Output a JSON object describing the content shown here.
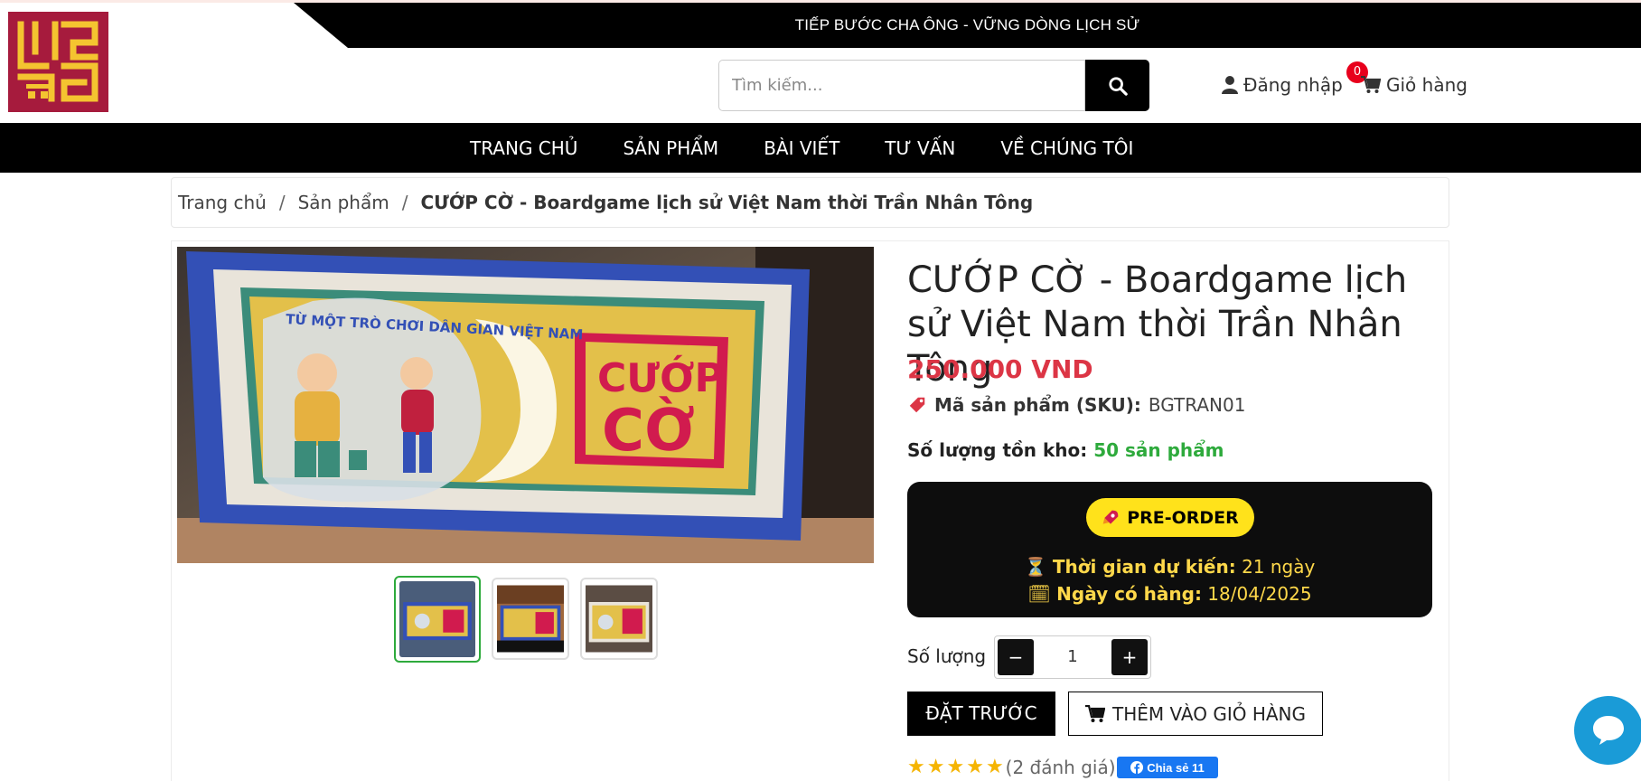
{
  "header": {
    "slogan": "TIẾP BƯỚC CHA ÔNG - VỮNG DÒNG LỊCH SỬ",
    "search_placeholder": "Tìm kiếm...",
    "login_label": "Đăng nhập",
    "cart_label": "Giỏ hàng",
    "cart_count": "0"
  },
  "nav": {
    "items": [
      "TRANG CHỦ",
      "SẢN PHẨM",
      "BÀI VIẾT",
      "TƯ VẤN",
      "VỀ CHÚNG TÔI"
    ]
  },
  "breadcrumb": {
    "items": [
      "Trang chủ",
      "Sản phẩm"
    ],
    "current": "CƯỚP CỜ - Boardgame lịch sử Việt Nam thời Trần Nhân Tông"
  },
  "product": {
    "title": "CƯỚP CỜ - Boardgame lịch sử Việt Nam thời Trần Nhân Tông",
    "price": "250.000 VND",
    "sku_label": "Mã sản phẩm (SKU):",
    "sku_value": "BGTRAN01",
    "stock_label": "Số lượng tồn kho:",
    "stock_value": "50 sản phẩm",
    "image_box_text_top": "TỪ MỘT TRÒ CHƠI DÂN GIAN VIỆT NAM",
    "image_box_title_1": "CƯỚP",
    "image_box_title_2": "CỜ"
  },
  "preorder": {
    "badge": "PRE-ORDER",
    "time_label": "Thời gian dự kiến:",
    "time_value": "21 ngày",
    "date_label": "Ngày có hàng:",
    "date_value": "18/04/2025"
  },
  "purchase": {
    "qty_label": "Số lượng",
    "qty_value": "1",
    "minus": "−",
    "plus": "+",
    "order_button": "ĐẶT TRƯỚC",
    "cart_button": "THÊM VÀO GIỎ HÀNG"
  },
  "rating": {
    "stars": 5,
    "count_text": "(2 đánh giá)",
    "share_label": "Chia sẻ 11"
  },
  "colors": {
    "accent_red": "#dc3545",
    "stock_green": "#2eaa3c",
    "preorder_yellow": "#ffe21b",
    "logo_bg": "#a61b3d",
    "facebook_blue": "#1877f2",
    "chat_blue": "#1a9bd7"
  },
  "icons": [
    "search-icon",
    "user-icon",
    "cart-icon",
    "tag-icon",
    "hourglass-icon",
    "calendar-icon",
    "rocket-icon",
    "star-icon",
    "facebook-icon",
    "chat-icon"
  ]
}
